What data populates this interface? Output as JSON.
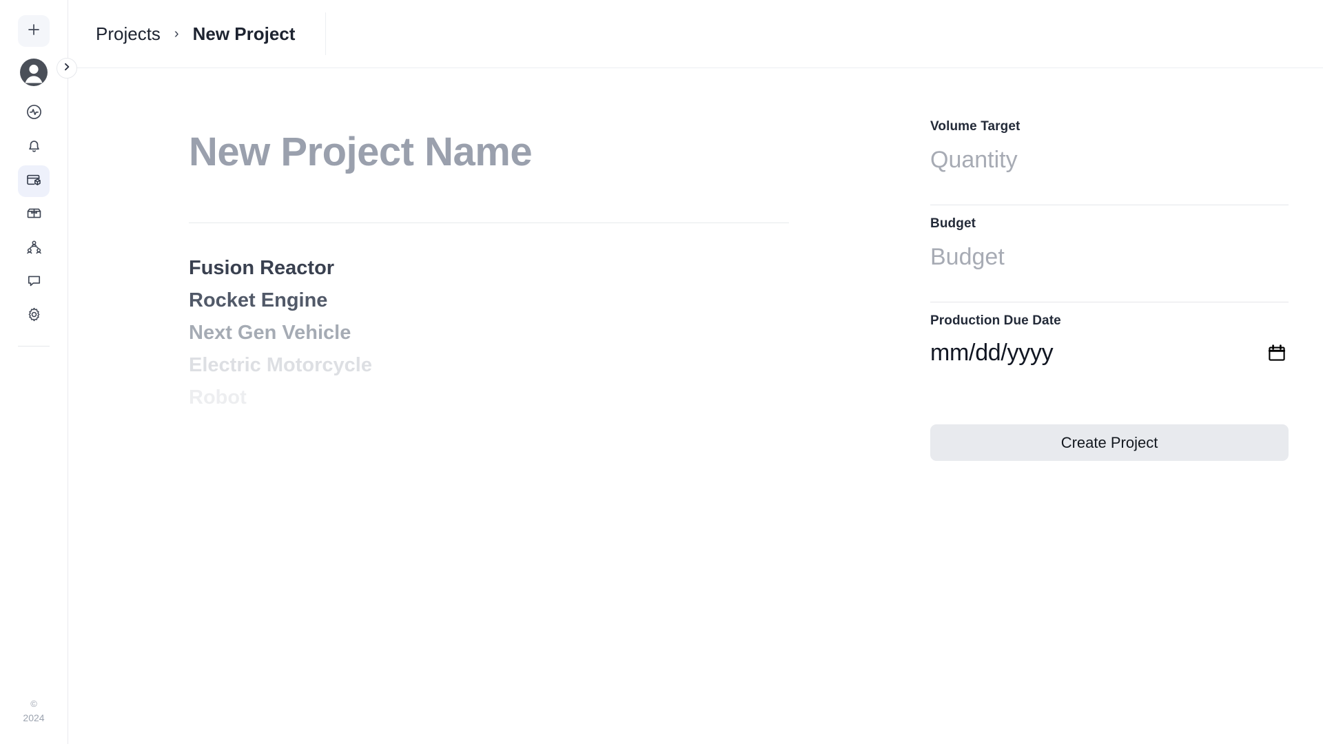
{
  "sidebar": {
    "add_button": {
      "icon": "plus-icon",
      "label": ""
    },
    "avatar": {
      "icon": "user-avatar-icon",
      "label": ""
    },
    "nav_items": [
      {
        "icon": "activity-pulse-icon",
        "label": ""
      },
      {
        "icon": "bell-icon",
        "label": ""
      },
      {
        "icon": "projects-box-icon",
        "label": "",
        "active": true
      },
      {
        "icon": "inventory-box-icon",
        "label": ""
      },
      {
        "icon": "team-people-icon",
        "label": ""
      },
      {
        "icon": "chat-bubble-icon",
        "label": ""
      },
      {
        "icon": "gear-icon",
        "label": ""
      }
    ],
    "collapse_toggle": {
      "icon": "chevron-right-icon"
    },
    "footer": {
      "copyright_symbol": "©",
      "year": "2024"
    }
  },
  "breadcrumb": {
    "parent": "Projects",
    "separator": "›",
    "current": "New Project"
  },
  "project_form": {
    "name_placeholder": "New Project Name",
    "name_value": "",
    "suggestions": [
      "Fusion Reactor",
      "Rocket Engine",
      "Next Gen Vehicle",
      "Electric Motorcycle",
      "Robot"
    ]
  },
  "details": {
    "volume_target": {
      "label": "Volume Target",
      "placeholder": "Quantity",
      "value": ""
    },
    "budget": {
      "label": "Budget",
      "placeholder": "Budget",
      "value": ""
    },
    "production_due_date": {
      "label": "Production Due Date",
      "placeholder": "mm/dd/yyyy",
      "value": "",
      "icon": "calendar-icon"
    },
    "submit_label": "Create Project"
  },
  "colors": {
    "accent_active_bg": "#eef1fb",
    "button_bg": "#e8eaee",
    "text_primary": "#1d2330",
    "text_muted": "#a7abb4",
    "border": "#e7e9ec"
  }
}
